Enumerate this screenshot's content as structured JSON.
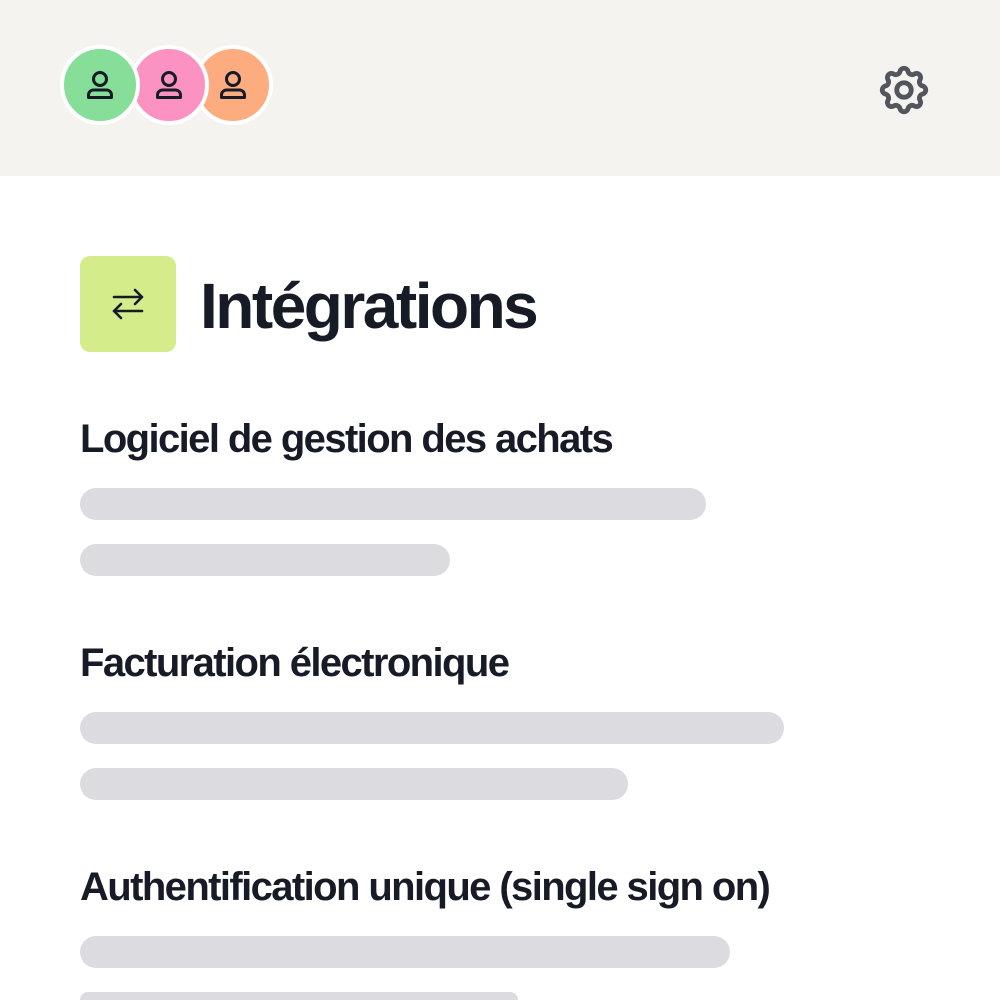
{
  "header": {
    "avatars": [
      {
        "icon": "user-icon",
        "color": "#86de98"
      },
      {
        "icon": "user-icon",
        "color": "#fb92c2"
      },
      {
        "icon": "user-icon",
        "color": "#fdac80"
      }
    ],
    "settings_icon": "gear-icon",
    "background": "#f4f3f0"
  },
  "page": {
    "title": "Intégrations",
    "title_icon": "arrows-exchange-icon",
    "title_icon_color": "#d5ec8a"
  },
  "sections": [
    {
      "title": "Logiciel de gestion des achats"
    },
    {
      "title": "Facturation électronique"
    },
    {
      "title": "Authentification unique (single sign on)"
    }
  ],
  "colors": {
    "text": "#161b26",
    "skeleton": "#dcdbe0"
  }
}
